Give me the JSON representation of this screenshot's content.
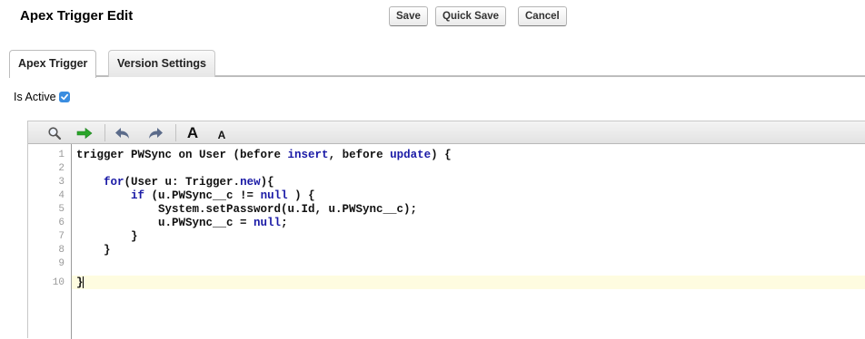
{
  "header": {
    "title": "Apex Trigger Edit",
    "buttons": {
      "save": "Save",
      "quick_save": "Quick Save",
      "cancel": "Cancel"
    }
  },
  "tabs": [
    {
      "label": "Apex Trigger",
      "active": true
    },
    {
      "label": "Version Settings",
      "active": false
    }
  ],
  "is_active": {
    "label": "Is Active",
    "checked": true
  },
  "toolbar": {
    "icons": [
      "search-icon",
      "go-to-line-arrow-icon",
      "undo-icon",
      "redo-icon",
      "increase-font-icon",
      "decrease-font-icon"
    ],
    "font_large": "A",
    "font_small": "A"
  },
  "editor": {
    "line_numbers": [
      "1",
      "2",
      "3",
      "4",
      "5",
      "6",
      "7",
      "8",
      "9",
      "10"
    ],
    "lines": [
      {
        "text": "trigger PWSync on User (before insert, before update) {"
      },
      {
        "text": ""
      },
      {
        "text": "    for(User u: Trigger.new){"
      },
      {
        "text": "        if (u.PWSync__c != null ) {"
      },
      {
        "text": "            System.setPassword(u.Id, u.PWSync__c);"
      },
      {
        "text": "            u.PWSync__c = null;"
      },
      {
        "text": "        }"
      },
      {
        "text": "    }"
      },
      {
        "text": ""
      },
      {
        "text": "}"
      }
    ],
    "current_line": 10
  },
  "colors": {
    "keyword": "#1a1aa6",
    "active_line": "#fefce0",
    "checkbox": "#3a8de0",
    "green_arrow": "#2aa52a",
    "undo_redo": "#5b6b8a"
  }
}
